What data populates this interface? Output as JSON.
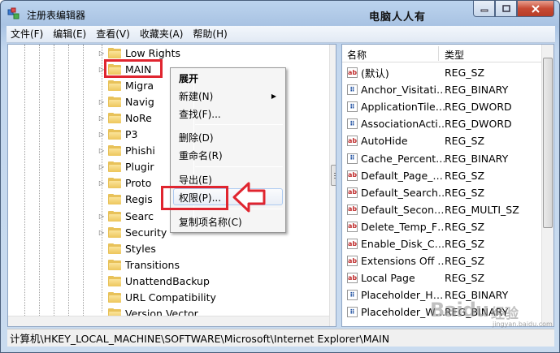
{
  "window": {
    "title": "注册表编辑器",
    "watermark_top": "电脑人人有",
    "caption_buttons": {
      "minimize": "—",
      "maximize": "□",
      "close": "✕"
    }
  },
  "menubar": [
    "文件(F)",
    "编辑(E)",
    "查看(V)",
    "收藏夹(A)",
    "帮助(H)"
  ],
  "tree": {
    "items": [
      {
        "label": "Low Rights",
        "expandable": true
      },
      {
        "label": "MAIN",
        "expandable": true,
        "highlighted": true
      },
      {
        "label": "Migra",
        "expandable": false
      },
      {
        "label": "Navig",
        "expandable": true
      },
      {
        "label": "NoRe",
        "expandable": true
      },
      {
        "label": "P3",
        "expandable": true
      },
      {
        "label": "Phishi",
        "expandable": true
      },
      {
        "label": "Plugir",
        "expandable": true
      },
      {
        "label": "Proto",
        "expandable": true
      },
      {
        "label": "Regis",
        "expandable": false
      },
      {
        "label": "Searc",
        "expandable": true
      },
      {
        "label": "Security",
        "expandable": true
      },
      {
        "label": "Styles",
        "expandable": false
      },
      {
        "label": "Transitions",
        "expandable": false
      },
      {
        "label": "UnattendBackup",
        "expandable": false
      },
      {
        "label": "URL Compatibility",
        "expandable": false
      },
      {
        "label": "Version Vector",
        "expandable": false
      }
    ]
  },
  "context_menu": {
    "items": [
      {
        "label": "展开",
        "bold": true
      },
      {
        "label": "新建(N)",
        "submenu": true
      },
      {
        "label": "查找(F)..."
      },
      {
        "label": "删除(D)"
      },
      {
        "label": "重命名(R)"
      },
      {
        "label": "导出(E)"
      },
      {
        "label": "权限(P)...",
        "highlighted": true
      },
      {
        "label": "复制项名称(C)"
      }
    ],
    "submenu_arrow": "▶"
  },
  "values_list": {
    "columns": {
      "name": "名称",
      "type": "类型"
    },
    "rows": [
      {
        "name": "(默认)",
        "type": "REG_SZ",
        "icon": "string-value-icon"
      },
      {
        "name": "Anchor_Visitati…",
        "type": "REG_BINARY",
        "icon": "binary-value-icon"
      },
      {
        "name": "ApplicationTile…",
        "type": "REG_DWORD",
        "icon": "binary-value-icon"
      },
      {
        "name": "AssociationActi…",
        "type": "REG_DWORD",
        "icon": "binary-value-icon"
      },
      {
        "name": "AutoHide",
        "type": "REG_SZ",
        "icon": "string-value-icon"
      },
      {
        "name": "Cache_Percent…",
        "type": "REG_BINARY",
        "icon": "binary-value-icon"
      },
      {
        "name": "Default_Page_…",
        "type": "REG_SZ",
        "icon": "string-value-icon"
      },
      {
        "name": "Default_Search…",
        "type": "REG_SZ",
        "icon": "string-value-icon"
      },
      {
        "name": "Default_Secon…",
        "type": "REG_MULTI_SZ",
        "icon": "string-value-icon"
      },
      {
        "name": "Delete_Temp_F…",
        "type": "REG_SZ",
        "icon": "string-value-icon"
      },
      {
        "name": "Enable_Disk_C…",
        "type": "REG_SZ",
        "icon": "string-value-icon"
      },
      {
        "name": "Extensions Off …",
        "type": "REG_SZ",
        "icon": "string-value-icon"
      },
      {
        "name": "Local Page",
        "type": "REG_SZ",
        "icon": "string-value-icon"
      },
      {
        "name": "Placeholder_H…",
        "type": "REG_BINARY",
        "icon": "binary-value-icon"
      },
      {
        "name": "Placeholder_W…",
        "type": "REG_BINARY",
        "icon": "binary-value-icon"
      }
    ]
  },
  "statusbar": {
    "path": "计算机\\HKEY_LOCAL_MACHINE\\SOFTWARE\\Microsoft\\Internet Explorer\\MAIN"
  },
  "watermark": {
    "brand": "Baidu",
    "suffix": "经验",
    "url": "jingyan.baidu.com"
  },
  "colors": {
    "highlight_red": "#e0252f",
    "folder": "#edc65c"
  }
}
